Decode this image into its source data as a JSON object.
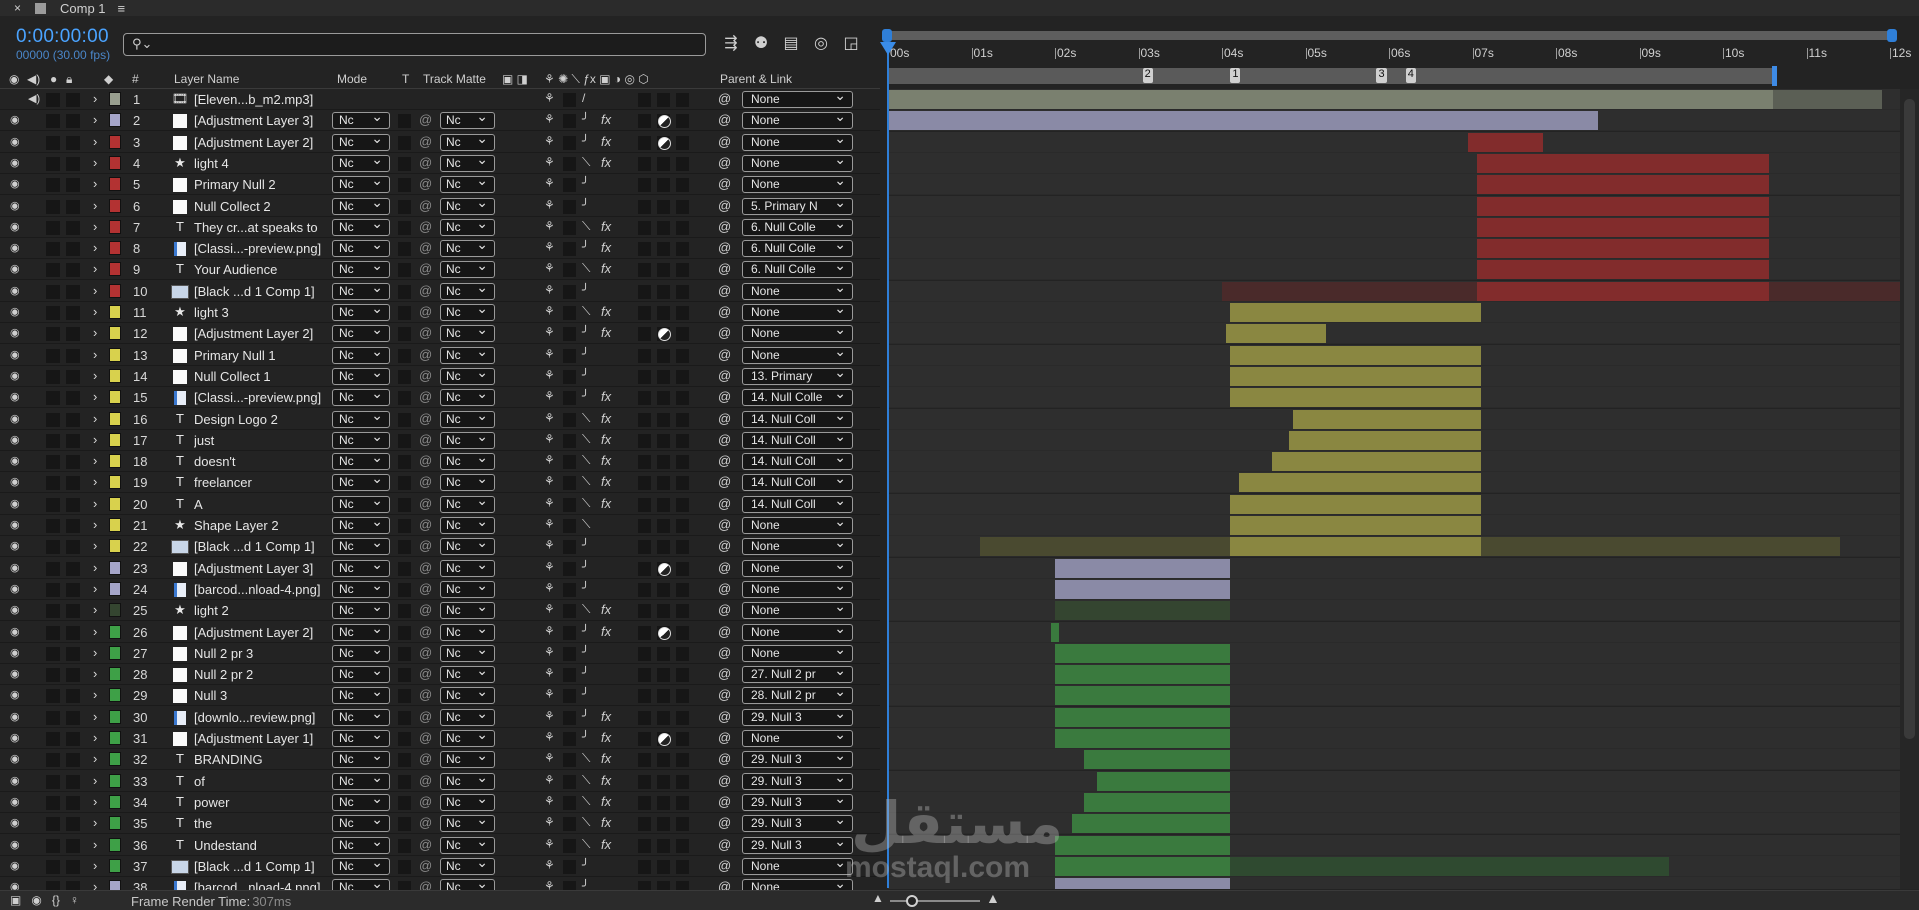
{
  "tab": {
    "close": "×",
    "name": "Comp 1",
    "menu": "≡"
  },
  "header": {
    "timecode": "0:00:00:00",
    "frames": "00000 (30.00 fps)",
    "search_icon": "⚲⌄",
    "search_value": ""
  },
  "columns": {
    "layer_name": "Layer Name",
    "mode": "Mode",
    "t": "T",
    "track_matte": "Track Matte",
    "parent_link": "Parent & Link",
    "hash": "#"
  },
  "ruler": {
    "ticks": [
      {
        "label": "00s",
        "pos": 0.0
      },
      {
        "label": "01s",
        "pos": 1.0
      },
      {
        "label": "02s",
        "pos": 2.0
      },
      {
        "label": "03s",
        "pos": 3.0
      },
      {
        "label": "04s",
        "pos": 4.0
      },
      {
        "label": "05s",
        "pos": 5.0
      },
      {
        "label": "06s",
        "pos": 6.0
      },
      {
        "label": "07s",
        "pos": 7.0
      },
      {
        "label": "08s",
        "pos": 8.0
      },
      {
        "label": "09s",
        "pos": 9.0
      },
      {
        "label": "10s",
        "pos": 10.0
      },
      {
        "label": "11s",
        "pos": 11.0
      },
      {
        "label": "12s",
        "pos": 12.0
      }
    ],
    "markers": [
      {
        "label": "2",
        "pos": 3.05
      },
      {
        "label": "1",
        "pos": 4.1
      },
      {
        "label": "3",
        "pos": 5.85
      },
      {
        "label": "4",
        "pos": 6.2
      }
    ],
    "work_area_end": 10.6
  },
  "colors": {
    "sand": "#999f8f",
    "lavender": "#a4a4c8",
    "red": "#b33232",
    "yellow": "#d8d14d",
    "darkgreen": "#344530",
    "green": "#3ea047",
    "bar_red": "#822c2c",
    "bar_yellow": "#8a8741",
    "bar_lav": "#8a8aa6",
    "bar_green": "#3a7a3e",
    "bar_sand": "#7a806f"
  },
  "layers": [
    {
      "num": "1",
      "type": "audio",
      "name": "[Eleven...b_m2.mp3]",
      "label": "sand",
      "mode": "",
      "tm": "",
      "parent": "None",
      "fx": false,
      "adj": false,
      "bar": [
        0,
        10.6
      ],
      "barColor": "bar_sand",
      "ext": [
        10.6,
        11.9
      ]
    },
    {
      "num": "2",
      "type": "solid",
      "name": "[Adjustment Layer 3]",
      "label": "lavender",
      "mode": "Nc",
      "tm": "Nc",
      "parent": "None",
      "fx": true,
      "adj": true,
      "bar": [
        0,
        8.5
      ],
      "barColor": "bar_lav"
    },
    {
      "num": "3",
      "type": "solid",
      "name": "[Adjustment Layer 2]",
      "label": "red",
      "mode": "Nc",
      "tm": "Nc",
      "parent": "None",
      "fx": true,
      "adj": true,
      "bar": [
        6.95,
        7.85
      ],
      "barColor": "bar_red"
    },
    {
      "num": "4",
      "type": "light",
      "name": "light 4",
      "label": "red",
      "mode": "Nc",
      "tm": "Nc",
      "parent": "None",
      "fx": true,
      "adj": false,
      "bar": [
        7.05,
        10.55
      ],
      "barColor": "bar_red"
    },
    {
      "num": "5",
      "type": "solid",
      "name": "Primary Null 2",
      "label": "red",
      "mode": "Nc",
      "tm": "Nc",
      "parent": "None",
      "fx": false,
      "adj": false,
      "bar": [
        7.05,
        10.55
      ],
      "barColor": "bar_red"
    },
    {
      "num": "6",
      "type": "solid",
      "name": "Null Collect  2",
      "label": "red",
      "mode": "Nc",
      "tm": "Nc",
      "parent": "5. Primary N",
      "fx": false,
      "adj": false,
      "bar": [
        7.05,
        10.55
      ],
      "barColor": "bar_red"
    },
    {
      "num": "7",
      "type": "text",
      "name": "They cr...at  speaks to",
      "label": "red",
      "mode": "Nc",
      "tm": "Nc",
      "parent": "6. Null Colle",
      "fx": true,
      "adj": false,
      "bar": [
        7.05,
        10.55
      ],
      "barColor": "bar_red"
    },
    {
      "num": "8",
      "type": "file",
      "name": "[Classi...-preview.png]",
      "label": "red",
      "mode": "Nc",
      "tm": "Nc",
      "parent": "6. Null Colle",
      "fx": true,
      "adj": false,
      "bar": [
        7.05,
        10.55
      ],
      "barColor": "bar_red"
    },
    {
      "num": "9",
      "type": "text",
      "name": "Your Audience",
      "label": "red",
      "mode": "Nc",
      "tm": "Nc",
      "parent": "6. Null Colle",
      "fx": true,
      "adj": false,
      "bar": [
        7.05,
        10.55
      ],
      "barColor": "bar_red"
    },
    {
      "num": "10",
      "type": "comp",
      "name": "[Black ...d 1 Comp 1]",
      "label": "red",
      "mode": "Nc",
      "tm": "Nc",
      "parent": "None",
      "fx": false,
      "adj": false,
      "bar": [
        7.05,
        10.55
      ],
      "barColor": "bar_red",
      "ext": [
        4.0,
        12.2
      ],
      "extColor": "#4a2a2a"
    },
    {
      "num": "11",
      "type": "light",
      "name": "light 3",
      "label": "yellow",
      "mode": "Nc",
      "tm": "Nc",
      "parent": "None",
      "fx": true,
      "adj": false,
      "bar": [
        4.1,
        7.1
      ],
      "barColor": "bar_yellow"
    },
    {
      "num": "12",
      "type": "solid",
      "name": "[Adjustment Layer 2]",
      "label": "yellow",
      "mode": "Nc",
      "tm": "Nc",
      "parent": "None",
      "fx": true,
      "adj": true,
      "bar": [
        4.05,
        5.25
      ],
      "barColor": "bar_yellow"
    },
    {
      "num": "13",
      "type": "solid",
      "name": "Primary Null 1",
      "label": "yellow",
      "mode": "Nc",
      "tm": "Nc",
      "parent": "None",
      "fx": false,
      "adj": false,
      "bar": [
        4.1,
        7.1
      ],
      "barColor": "bar_yellow"
    },
    {
      "num": "14",
      "type": "solid",
      "name": "Null Collect  1",
      "label": "yellow",
      "mode": "Nc",
      "tm": "Nc",
      "parent": "13. Primary",
      "fx": false,
      "adj": false,
      "bar": [
        4.1,
        7.1
      ],
      "barColor": "bar_yellow"
    },
    {
      "num": "15",
      "type": "file",
      "name": "[Classi...-preview.png]",
      "label": "yellow",
      "mode": "Nc",
      "tm": "Nc",
      "parent": "14. Null Colle",
      "fx": true,
      "adj": false,
      "bar": [
        4.1,
        7.1
      ],
      "barColor": "bar_yellow"
    },
    {
      "num": "16",
      "type": "text",
      "name": "Design Logo 2",
      "label": "yellow",
      "mode": "Nc",
      "tm": "Nc",
      "parent": "14. Null Coll",
      "fx": true,
      "adj": false,
      "bar": [
        4.85,
        7.1
      ],
      "barColor": "bar_yellow"
    },
    {
      "num": "17",
      "type": "text",
      "name": "just",
      "label": "yellow",
      "mode": "Nc",
      "tm": "Nc",
      "parent": "14. Null Coll",
      "fx": true,
      "adj": false,
      "bar": [
        4.8,
        7.1
      ],
      "barColor": "bar_yellow"
    },
    {
      "num": "18",
      "type": "text",
      "name": "doesn't",
      "label": "yellow",
      "mode": "Nc",
      "tm": "Nc",
      "parent": "14. Null Coll",
      "fx": true,
      "adj": false,
      "bar": [
        4.6,
        7.1
      ],
      "barColor": "bar_yellow"
    },
    {
      "num": "19",
      "type": "text",
      "name": "freelancer",
      "label": "yellow",
      "mode": "Nc",
      "tm": "Nc",
      "parent": "14. Null Coll",
      "fx": true,
      "adj": false,
      "bar": [
        4.2,
        7.1
      ],
      "barColor": "bar_yellow"
    },
    {
      "num": "20",
      "type": "text",
      "name": "A",
      "label": "yellow",
      "mode": "Nc",
      "tm": "Nc",
      "parent": "14. Null Coll",
      "fx": true,
      "adj": false,
      "bar": [
        4.1,
        7.1
      ],
      "barColor": "bar_yellow"
    },
    {
      "num": "21",
      "type": "light",
      "name": "Shape Layer 2",
      "label": "yellow",
      "mode": "Nc",
      "tm": "Nc",
      "parent": "None",
      "fx": false,
      "adj": false,
      "bar": [
        4.1,
        7.1
      ],
      "barColor": "bar_yellow"
    },
    {
      "num": "22",
      "type": "comp",
      "name": "[Black ...d 1 Comp 1]",
      "label": "yellow",
      "mode": "Nc",
      "tm": "Nc",
      "parent": "None",
      "fx": false,
      "adj": false,
      "bar": [
        4.1,
        7.1
      ],
      "barColor": "bar_yellow",
      "ext": [
        1.1,
        11.4
      ],
      "extColor": "#4a4a30"
    },
    {
      "num": "23",
      "type": "solid",
      "name": "[Adjustment Layer 3]",
      "label": "lavender",
      "mode": "Nc",
      "tm": "Nc",
      "parent": "None",
      "fx": false,
      "adj": true,
      "bar": [
        2.0,
        4.1
      ],
      "barColor": "bar_lav"
    },
    {
      "num": "24",
      "type": "file",
      "name": "[barcod...nload-4.png]",
      "label": "lavender",
      "mode": "Nc",
      "tm": "Nc",
      "parent": "None",
      "fx": false,
      "adj": false,
      "bar": [
        2.0,
        4.1
      ],
      "barColor": "bar_lav"
    },
    {
      "num": "25",
      "type": "light",
      "name": "light 2",
      "label": "darkgreen",
      "mode": "Nc",
      "tm": "Nc",
      "parent": "None",
      "fx": true,
      "adj": false,
      "bar": [
        2.0,
        4.1
      ],
      "barColor": "darkgreen"
    },
    {
      "num": "26",
      "type": "solid",
      "name": "[Adjustment Layer 2]",
      "label": "green",
      "mode": "Nc",
      "tm": "Nc",
      "parent": "None",
      "fx": true,
      "adj": true,
      "bar": [
        1.95,
        2.05
      ],
      "barColor": "bar_green"
    },
    {
      "num": "27",
      "type": "solid",
      "name": "Null 2 pr 3",
      "label": "green",
      "mode": "Nc",
      "tm": "Nc",
      "parent": "None",
      "fx": false,
      "adj": false,
      "bar": [
        2.0,
        4.1
      ],
      "barColor": "bar_green"
    },
    {
      "num": "28",
      "type": "solid",
      "name": "Null 2 pr 2",
      "label": "green",
      "mode": "Nc",
      "tm": "Nc",
      "parent": "27. Null 2 pr",
      "fx": false,
      "adj": false,
      "bar": [
        2.0,
        4.1
      ],
      "barColor": "bar_green"
    },
    {
      "num": "29",
      "type": "solid",
      "name": "Null 3",
      "label": "green",
      "mode": "Nc",
      "tm": "Nc",
      "parent": "28. Null 2 pr",
      "fx": false,
      "adj": false,
      "bar": [
        2.0,
        4.1
      ],
      "barColor": "bar_green"
    },
    {
      "num": "30",
      "type": "file",
      "name": "[downlo...review.png]",
      "label": "green",
      "mode": "Nc",
      "tm": "Nc",
      "parent": "29. Null 3",
      "fx": true,
      "adj": false,
      "bar": [
        2.0,
        4.1
      ],
      "barColor": "bar_green"
    },
    {
      "num": "31",
      "type": "solid",
      "name": "[Adjustment Layer 1]",
      "label": "green",
      "mode": "Nc",
      "tm": "Nc",
      "parent": "None",
      "fx": true,
      "adj": true,
      "bar": [
        2.0,
        4.1
      ],
      "barColor": "bar_green"
    },
    {
      "num": "32",
      "type": "text",
      "name": "BRANDING",
      "label": "green",
      "mode": "Nc",
      "tm": "Nc",
      "parent": "29. Null 3",
      "fx": true,
      "adj": false,
      "bar": [
        2.35,
        4.1
      ],
      "barColor": "bar_green"
    },
    {
      "num": "33",
      "type": "text",
      "name": "of",
      "label": "green",
      "mode": "Nc",
      "tm": "Nc",
      "parent": "29. Null 3",
      "fx": true,
      "adj": false,
      "bar": [
        2.5,
        4.1
      ],
      "barColor": "bar_green"
    },
    {
      "num": "34",
      "type": "text",
      "name": "power",
      "label": "green",
      "mode": "Nc",
      "tm": "Nc",
      "parent": "29. Null 3",
      "fx": true,
      "adj": false,
      "bar": [
        2.35,
        4.1
      ],
      "barColor": "bar_green"
    },
    {
      "num": "35",
      "type": "text",
      "name": "the",
      "label": "green",
      "mode": "Nc",
      "tm": "Nc",
      "parent": "29. Null 3",
      "fx": true,
      "adj": false,
      "bar": [
        2.2,
        4.1
      ],
      "barColor": "bar_green"
    },
    {
      "num": "36",
      "type": "text",
      "name": "Undestand",
      "label": "green",
      "mode": "Nc",
      "tm": "Nc",
      "parent": "29. Null 3",
      "fx": true,
      "adj": false,
      "bar": [
        2.0,
        4.1
      ],
      "barColor": "bar_green"
    },
    {
      "num": "37",
      "type": "comp",
      "name": "[Black ...d 1 Comp 1]",
      "label": "green",
      "mode": "Nc",
      "tm": "Nc",
      "parent": "None",
      "fx": false,
      "adj": false,
      "bar": [
        2.0,
        4.1
      ],
      "barColor": "bar_green",
      "ext": [
        4.1,
        9.35
      ],
      "extColor": "#2f4a30"
    },
    {
      "num": "38",
      "type": "file",
      "name": "[barcod...nload-4.png]",
      "label": "lavender",
      "mode": "Nc",
      "tm": "Nc",
      "parent": "None",
      "fx": false,
      "adj": false,
      "bar": [
        2.0,
        4.1
      ],
      "barColor": "bar_lav"
    }
  ],
  "footer": {
    "label": "Frame Render Time:",
    "value": "307ms"
  },
  "watermark": {
    "arabic": "مستقل",
    "latin": "mostaql.com"
  }
}
